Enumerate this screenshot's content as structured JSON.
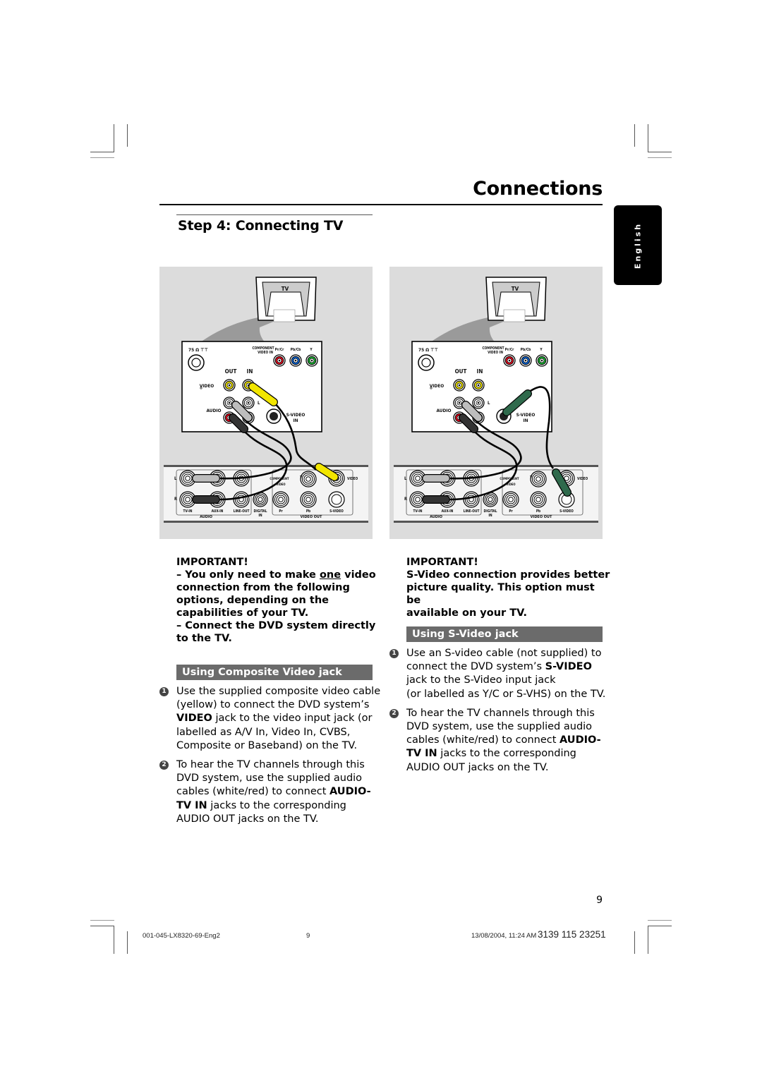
{
  "header": {
    "section_title": "Connections",
    "step_title": "Step 4:  Connecting TV",
    "language_tab": "English"
  },
  "diagram_left": {
    "tv_label": "TV",
    "tv_panel": {
      "antenna_label": "75 Ω ⊤⊤",
      "component_label_1": "COMPONENT",
      "component_label_2": "VIDEO IN",
      "pr_label": "Pr/Cr",
      "pb_label": "Pb/Cb",
      "y_label": "Y",
      "out_label": "OUT",
      "in_label": "IN",
      "video_label": "VIDEO",
      "audio_label": "AUDIO",
      "l_label": "L",
      "svideo_label_1": "S-VIDEO",
      "svideo_label_2": "IN"
    },
    "dvd_panel": {
      "l_label": "L",
      "r_label": "R",
      "tv_in": "TV-IN",
      "aux_in": "AUX-IN",
      "line_out": "LINE-OUT",
      "digital_1": "DIGITAL",
      "digital_2": "IN",
      "component_1": "COMPONENT",
      "component_2": "VIDEO",
      "y_label": "Y",
      "pr_label": "Pr",
      "pb_label": "Pb",
      "video_label": "VIDEO",
      "svideo_label": "S-VIDEO",
      "audio_group": "AUDIO",
      "video_out_group": "VIDEO OUT"
    },
    "connection": "composite"
  },
  "diagram_right": {
    "tv_label": "TV",
    "connection": "s-video"
  },
  "left_column": {
    "important_heading": "IMPORTANT!",
    "important_lines": [
      "–  You only need to make ",
      "one",
      " video",
      "connection from the following",
      "options, depending on the",
      "capabilities of your TV.",
      "–  Connect the DVD system directly",
      "to the TV."
    ],
    "section_heading": "Using Composite Video jack",
    "steps": [
      {
        "num": "1",
        "lines": [
          "Use the supplied composite video cable",
          "(yellow) to connect the DVD system’s",
          [
            "VIDEO",
            " jack to the video input jack (or"
          ],
          "labelled as A/V In, Video In, CVBS,",
          "Composite or Baseband) on the TV."
        ]
      },
      {
        "num": "2",
        "lines": [
          "To hear the TV channels through this",
          "DVD system, use the supplied audio",
          [
            "cables (white/red) to connect ",
            "AUDIO-"
          ],
          [
            "TV IN",
            " jacks to the corresponding"
          ],
          "AUDIO OUT jacks on the TV."
        ]
      }
    ]
  },
  "right_column": {
    "important_heading": "IMPORTANT!",
    "important_lines": [
      "S-Video connection provides better",
      "picture quality.  This option must be",
      "available on your TV."
    ],
    "section_heading": "Using S-Video jack",
    "steps": [
      {
        "num": "1",
        "lines": [
          "Use an S-video cable (not supplied) to",
          [
            "connect the DVD system’s ",
            "S-VIDEO"
          ],
          "jack to the S-Video input jack",
          "(or labelled as Y/C or S-VHS) on the TV."
        ]
      },
      {
        "num": "2",
        "lines": [
          "To hear the TV channels through this",
          "DVD system, use the supplied audio",
          [
            "cables (white/red) to connect ",
            "AUDIO-"
          ],
          [
            "TV IN",
            " jacks to the corresponding"
          ],
          "AUDIO OUT jacks on the TV."
        ]
      }
    ]
  },
  "footer": {
    "page_number": "9",
    "file_name": "001-045-LX8320-69-Eng2",
    "sheet_number": "9",
    "timestamp": "13/08/2004, 11:24 AM",
    "product_code": "3139 115 23251"
  },
  "colors": {
    "panel_bg": "#dcdcdc",
    "section_bar": "#6b6b6b",
    "yellow_cable": "#f2e600",
    "red_jack": "#e0001b",
    "blue_jack": "#0060d0",
    "green_jack": "#18b030"
  }
}
